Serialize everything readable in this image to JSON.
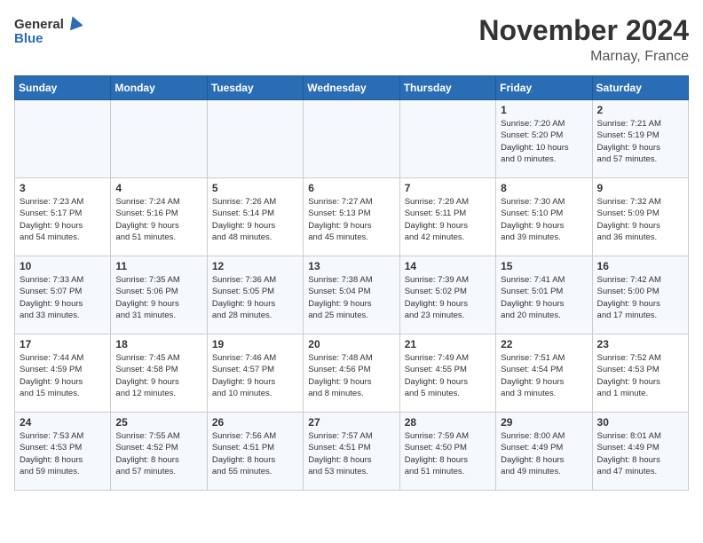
{
  "header": {
    "title": "November 2024",
    "subtitle": "Marnay, France",
    "logo_general": "General",
    "logo_blue": "Blue"
  },
  "days_of_week": [
    "Sunday",
    "Monday",
    "Tuesday",
    "Wednesday",
    "Thursday",
    "Friday",
    "Saturday"
  ],
  "weeks": [
    [
      {
        "day": "",
        "info": ""
      },
      {
        "day": "",
        "info": ""
      },
      {
        "day": "",
        "info": ""
      },
      {
        "day": "",
        "info": ""
      },
      {
        "day": "",
        "info": ""
      },
      {
        "day": "1",
        "info": "Sunrise: 7:20 AM\nSunset: 5:20 PM\nDaylight: 10 hours\nand 0 minutes."
      },
      {
        "day": "2",
        "info": "Sunrise: 7:21 AM\nSunset: 5:19 PM\nDaylight: 9 hours\nand 57 minutes."
      }
    ],
    [
      {
        "day": "3",
        "info": "Sunrise: 7:23 AM\nSunset: 5:17 PM\nDaylight: 9 hours\nand 54 minutes."
      },
      {
        "day": "4",
        "info": "Sunrise: 7:24 AM\nSunset: 5:16 PM\nDaylight: 9 hours\nand 51 minutes."
      },
      {
        "day": "5",
        "info": "Sunrise: 7:26 AM\nSunset: 5:14 PM\nDaylight: 9 hours\nand 48 minutes."
      },
      {
        "day": "6",
        "info": "Sunrise: 7:27 AM\nSunset: 5:13 PM\nDaylight: 9 hours\nand 45 minutes."
      },
      {
        "day": "7",
        "info": "Sunrise: 7:29 AM\nSunset: 5:11 PM\nDaylight: 9 hours\nand 42 minutes."
      },
      {
        "day": "8",
        "info": "Sunrise: 7:30 AM\nSunset: 5:10 PM\nDaylight: 9 hours\nand 39 minutes."
      },
      {
        "day": "9",
        "info": "Sunrise: 7:32 AM\nSunset: 5:09 PM\nDaylight: 9 hours\nand 36 minutes."
      }
    ],
    [
      {
        "day": "10",
        "info": "Sunrise: 7:33 AM\nSunset: 5:07 PM\nDaylight: 9 hours\nand 33 minutes."
      },
      {
        "day": "11",
        "info": "Sunrise: 7:35 AM\nSunset: 5:06 PM\nDaylight: 9 hours\nand 31 minutes."
      },
      {
        "day": "12",
        "info": "Sunrise: 7:36 AM\nSunset: 5:05 PM\nDaylight: 9 hours\nand 28 minutes."
      },
      {
        "day": "13",
        "info": "Sunrise: 7:38 AM\nSunset: 5:04 PM\nDaylight: 9 hours\nand 25 minutes."
      },
      {
        "day": "14",
        "info": "Sunrise: 7:39 AM\nSunset: 5:02 PM\nDaylight: 9 hours\nand 23 minutes."
      },
      {
        "day": "15",
        "info": "Sunrise: 7:41 AM\nSunset: 5:01 PM\nDaylight: 9 hours\nand 20 minutes."
      },
      {
        "day": "16",
        "info": "Sunrise: 7:42 AM\nSunset: 5:00 PM\nDaylight: 9 hours\nand 17 minutes."
      }
    ],
    [
      {
        "day": "17",
        "info": "Sunrise: 7:44 AM\nSunset: 4:59 PM\nDaylight: 9 hours\nand 15 minutes."
      },
      {
        "day": "18",
        "info": "Sunrise: 7:45 AM\nSunset: 4:58 PM\nDaylight: 9 hours\nand 12 minutes."
      },
      {
        "day": "19",
        "info": "Sunrise: 7:46 AM\nSunset: 4:57 PM\nDaylight: 9 hours\nand 10 minutes."
      },
      {
        "day": "20",
        "info": "Sunrise: 7:48 AM\nSunset: 4:56 PM\nDaylight: 9 hours\nand 8 minutes."
      },
      {
        "day": "21",
        "info": "Sunrise: 7:49 AM\nSunset: 4:55 PM\nDaylight: 9 hours\nand 5 minutes."
      },
      {
        "day": "22",
        "info": "Sunrise: 7:51 AM\nSunset: 4:54 PM\nDaylight: 9 hours\nand 3 minutes."
      },
      {
        "day": "23",
        "info": "Sunrise: 7:52 AM\nSunset: 4:53 PM\nDaylight: 9 hours\nand 1 minute."
      }
    ],
    [
      {
        "day": "24",
        "info": "Sunrise: 7:53 AM\nSunset: 4:53 PM\nDaylight: 8 hours\nand 59 minutes."
      },
      {
        "day": "25",
        "info": "Sunrise: 7:55 AM\nSunset: 4:52 PM\nDaylight: 8 hours\nand 57 minutes."
      },
      {
        "day": "26",
        "info": "Sunrise: 7:56 AM\nSunset: 4:51 PM\nDaylight: 8 hours\nand 55 minutes."
      },
      {
        "day": "27",
        "info": "Sunrise: 7:57 AM\nSunset: 4:51 PM\nDaylight: 8 hours\nand 53 minutes."
      },
      {
        "day": "28",
        "info": "Sunrise: 7:59 AM\nSunset: 4:50 PM\nDaylight: 8 hours\nand 51 minutes."
      },
      {
        "day": "29",
        "info": "Sunrise: 8:00 AM\nSunset: 4:49 PM\nDaylight: 8 hours\nand 49 minutes."
      },
      {
        "day": "30",
        "info": "Sunrise: 8:01 AM\nSunset: 4:49 PM\nDaylight: 8 hours\nand 47 minutes."
      }
    ]
  ]
}
